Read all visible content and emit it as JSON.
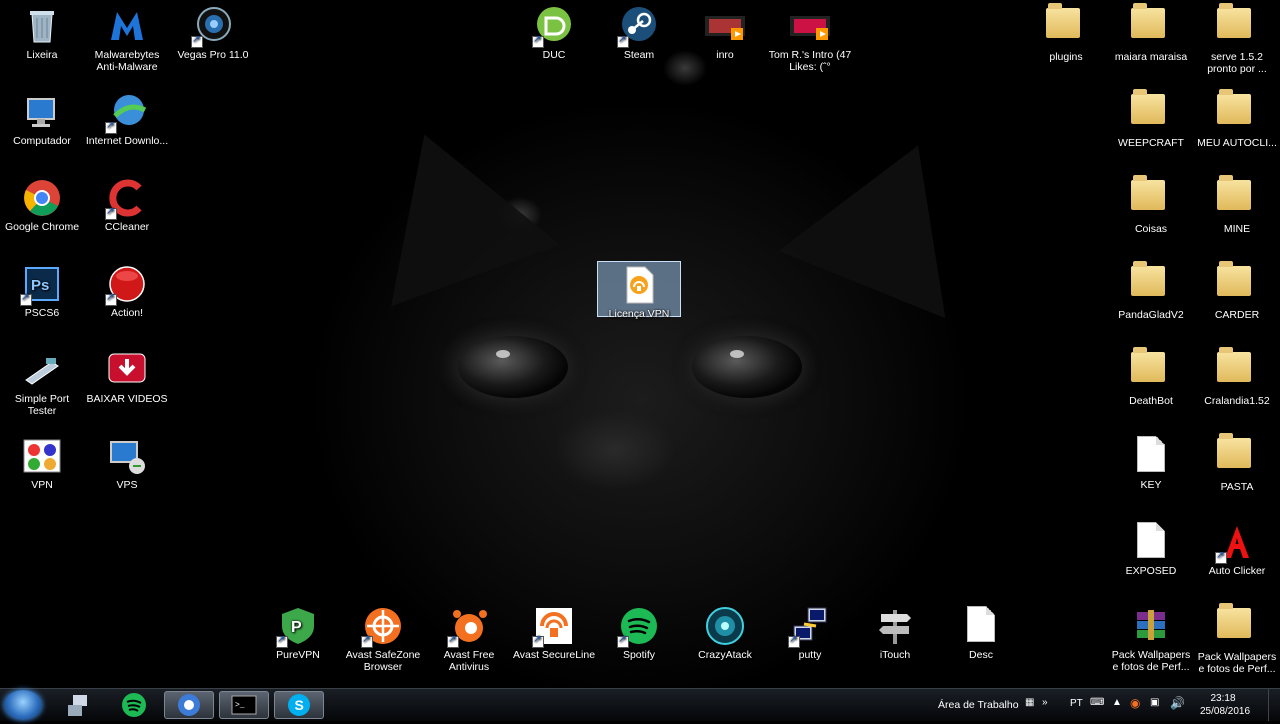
{
  "desktop_icons_left": [
    {
      "label": "Lixeira",
      "icon": "recycle-bin-icon"
    },
    {
      "label": "Malwarebytes Anti-Malware",
      "icon": "malwarebytes-icon"
    },
    {
      "label": "Vegas Pro 11.0",
      "icon": "vegas-pro-icon"
    },
    {
      "label": "Computador",
      "icon": "computer-icon"
    },
    {
      "label": "Internet Downlo...",
      "icon": "internet-download-icon"
    },
    {
      "label": "Google Chrome",
      "icon": "chrome-icon"
    },
    {
      "label": "CCleaner",
      "icon": "ccleaner-icon"
    },
    {
      "label": "PSCS6",
      "icon": "photoshop-icon"
    },
    {
      "label": "Action!",
      "icon": "action-icon"
    },
    {
      "label": "Simple Port Tester",
      "icon": "network-icon"
    },
    {
      "label": "BAIXAR VIDEOS",
      "icon": "download-icon"
    },
    {
      "label": "VPN",
      "icon": "vpn-icon"
    },
    {
      "label": "VPS",
      "icon": "remote-desktop-icon"
    }
  ],
  "desktop_icons_top": [
    {
      "label": "DUC",
      "icon": "duc-icon"
    },
    {
      "label": "Steam",
      "icon": "steam-icon"
    },
    {
      "label": "inro",
      "icon": "video-file-icon"
    },
    {
      "label": "Tom R.'s Intro (47 Likes: (ˆ°",
      "icon": "video-file-icon"
    }
  ],
  "selected_icon": {
    "label": "Licença VPN",
    "icon": "vpn-license-icon"
  },
  "desktop_icons_right": [
    {
      "label": "plugins",
      "icon": "folder-icon"
    },
    {
      "label": "maiara maraisa",
      "icon": "folder-icon"
    },
    {
      "label": "serve 1.5.2 pronto por ...",
      "icon": "folder-icon"
    },
    {
      "label": "WEEPCRAFT",
      "icon": "folder-icon"
    },
    {
      "label": "MEU AUTOCLI...",
      "icon": "folder-icon"
    },
    {
      "label": "Coisas",
      "icon": "folder-icon"
    },
    {
      "label": "MINE",
      "icon": "folder-icon"
    },
    {
      "label": "PandaGladV2",
      "icon": "folder-icon"
    },
    {
      "label": "CARDER",
      "icon": "folder-icon"
    },
    {
      "label": "DeathBot",
      "icon": "folder-icon"
    },
    {
      "label": "Cralandia1.52",
      "icon": "folder-icon"
    },
    {
      "label": "KEY",
      "icon": "text-file-icon"
    },
    {
      "label": "PASTA",
      "icon": "folder-icon"
    },
    {
      "label": "EXPOSED",
      "icon": "text-file-icon"
    },
    {
      "label": "Auto Clicker",
      "icon": "auto-clicker-icon"
    },
    {
      "label": "Pack Wallpapers e fotos de Perf...",
      "icon": "winrar-icon"
    },
    {
      "label": "Pack Wallpapers e fotos de Perf...",
      "icon": "folder-icon"
    }
  ],
  "desktop_icons_bottom": [
    {
      "label": "PureVPN",
      "icon": "purevpn-icon"
    },
    {
      "label": "Avast SafeZone Browser",
      "icon": "avast-safezone-icon"
    },
    {
      "label": "Avast Free Antivirus",
      "icon": "avast-icon"
    },
    {
      "label": "Avast SecureLine",
      "icon": "avast-secureline-icon"
    },
    {
      "label": "Spotify",
      "icon": "spotify-icon"
    },
    {
      "label": "CrazyAtack",
      "icon": "crazyatack-icon"
    },
    {
      "label": "putty",
      "icon": "putty-icon"
    },
    {
      "label": "iTouch",
      "icon": "signpost-icon"
    },
    {
      "label": "Desc",
      "icon": "text-file-icon"
    }
  ],
  "taskbar": {
    "desktop_label": "Área de Trabalho",
    "language": "PT",
    "time": "23:18",
    "date": "25/08/2016"
  }
}
